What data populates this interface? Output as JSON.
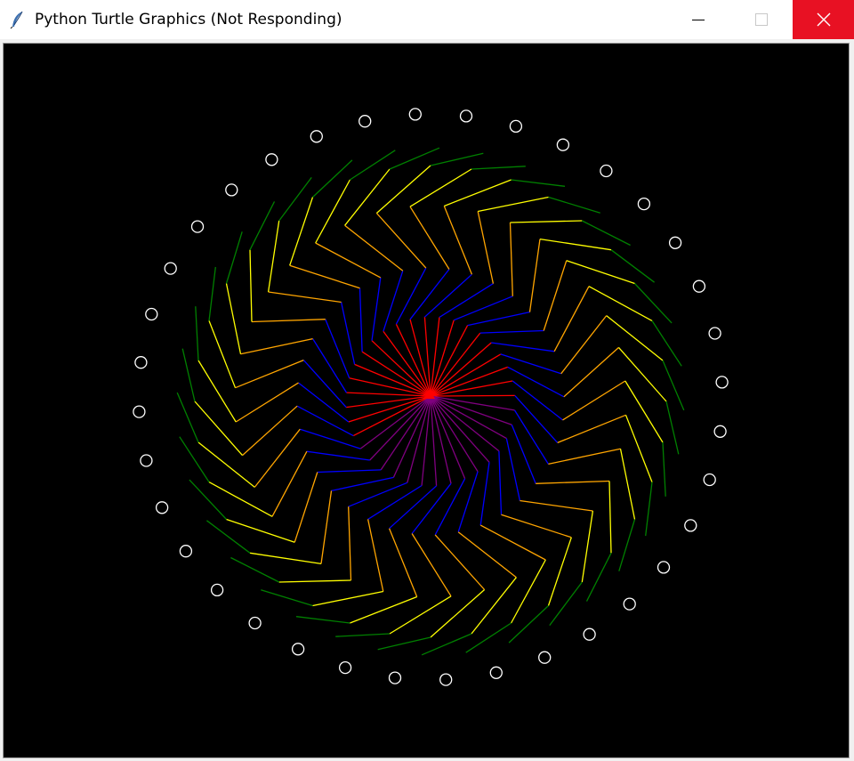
{
  "window": {
    "title": "Python Turtle Graphics (Not Responding)"
  },
  "icons": {
    "app": "feather-icon",
    "minimize": "minimize-icon",
    "maximize": "maximize-icon",
    "close": "close-icon"
  },
  "colors": {
    "canvas_background": "#000000",
    "close_button": "#e81123",
    "line_colors": [
      "red",
      "purple",
      "blue",
      "orange",
      "yellow",
      "green"
    ],
    "dot_color": "white"
  },
  "drawing": {
    "spokes": 36,
    "outer_dots": 36
  }
}
